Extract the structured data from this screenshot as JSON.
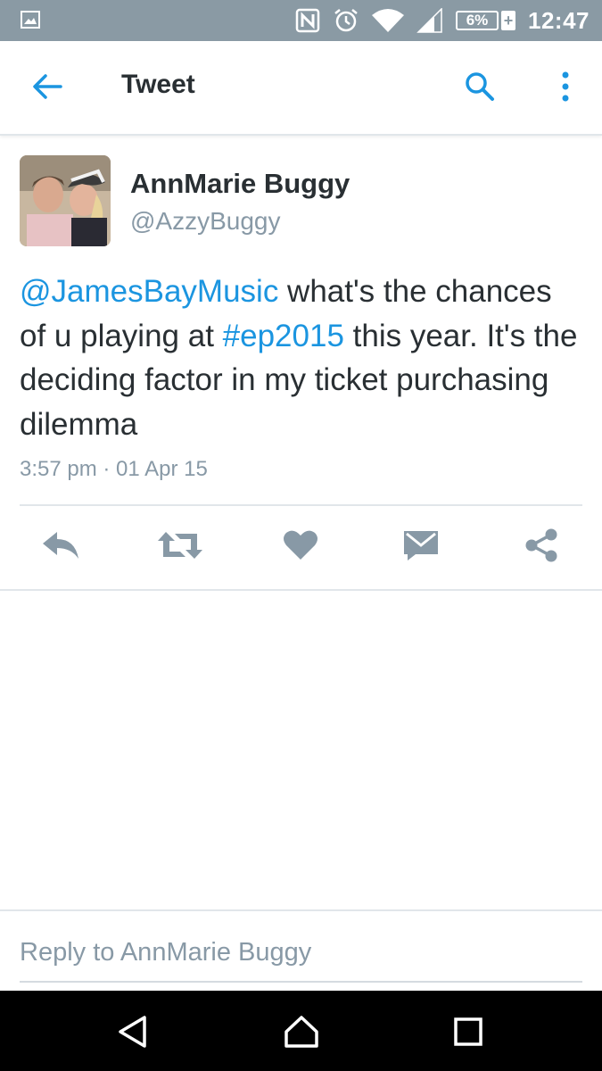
{
  "status_bar": {
    "battery_percent": "6%",
    "battery_plus": "+",
    "time": "12:47",
    "icons": [
      "gallery-icon",
      "nfc-icon",
      "alarm-icon",
      "wifi-icon",
      "signal-icon",
      "battery-icon"
    ]
  },
  "app_bar": {
    "title": "Tweet",
    "icons": [
      "back-arrow-icon",
      "search-icon",
      "more-vert-icon"
    ]
  },
  "tweet": {
    "author_name": "AnnMarie Buggy",
    "author_handle": "@AzzyBuggy",
    "text_parts": {
      "mention": "@JamesBayMusic",
      "part1": " what's the chances of u playing at ",
      "hashtag": "#ep2015",
      "part2": " this year. It's the deciding factor in my ticket purchasing dilemma"
    },
    "timestamp": "3:57 pm · 01 Apr 15",
    "actions": [
      "reply-icon",
      "retweet-icon",
      "like-icon",
      "direct-message-icon",
      "share-icon"
    ]
  },
  "reply": {
    "placeholder": "Reply to AnnMarie Buggy"
  },
  "nav_bar": {
    "icons": [
      "back-triangle-icon",
      "home-icon",
      "recents-icon"
    ]
  },
  "colors": {
    "status_bar": "#8a9aa4",
    "accent": "#1b95e0",
    "text_primary": "#292f33",
    "text_secondary": "#8899a6",
    "action_icon": "#8899a6",
    "divider": "#e1e6ea",
    "nav_bar": "#000000"
  }
}
